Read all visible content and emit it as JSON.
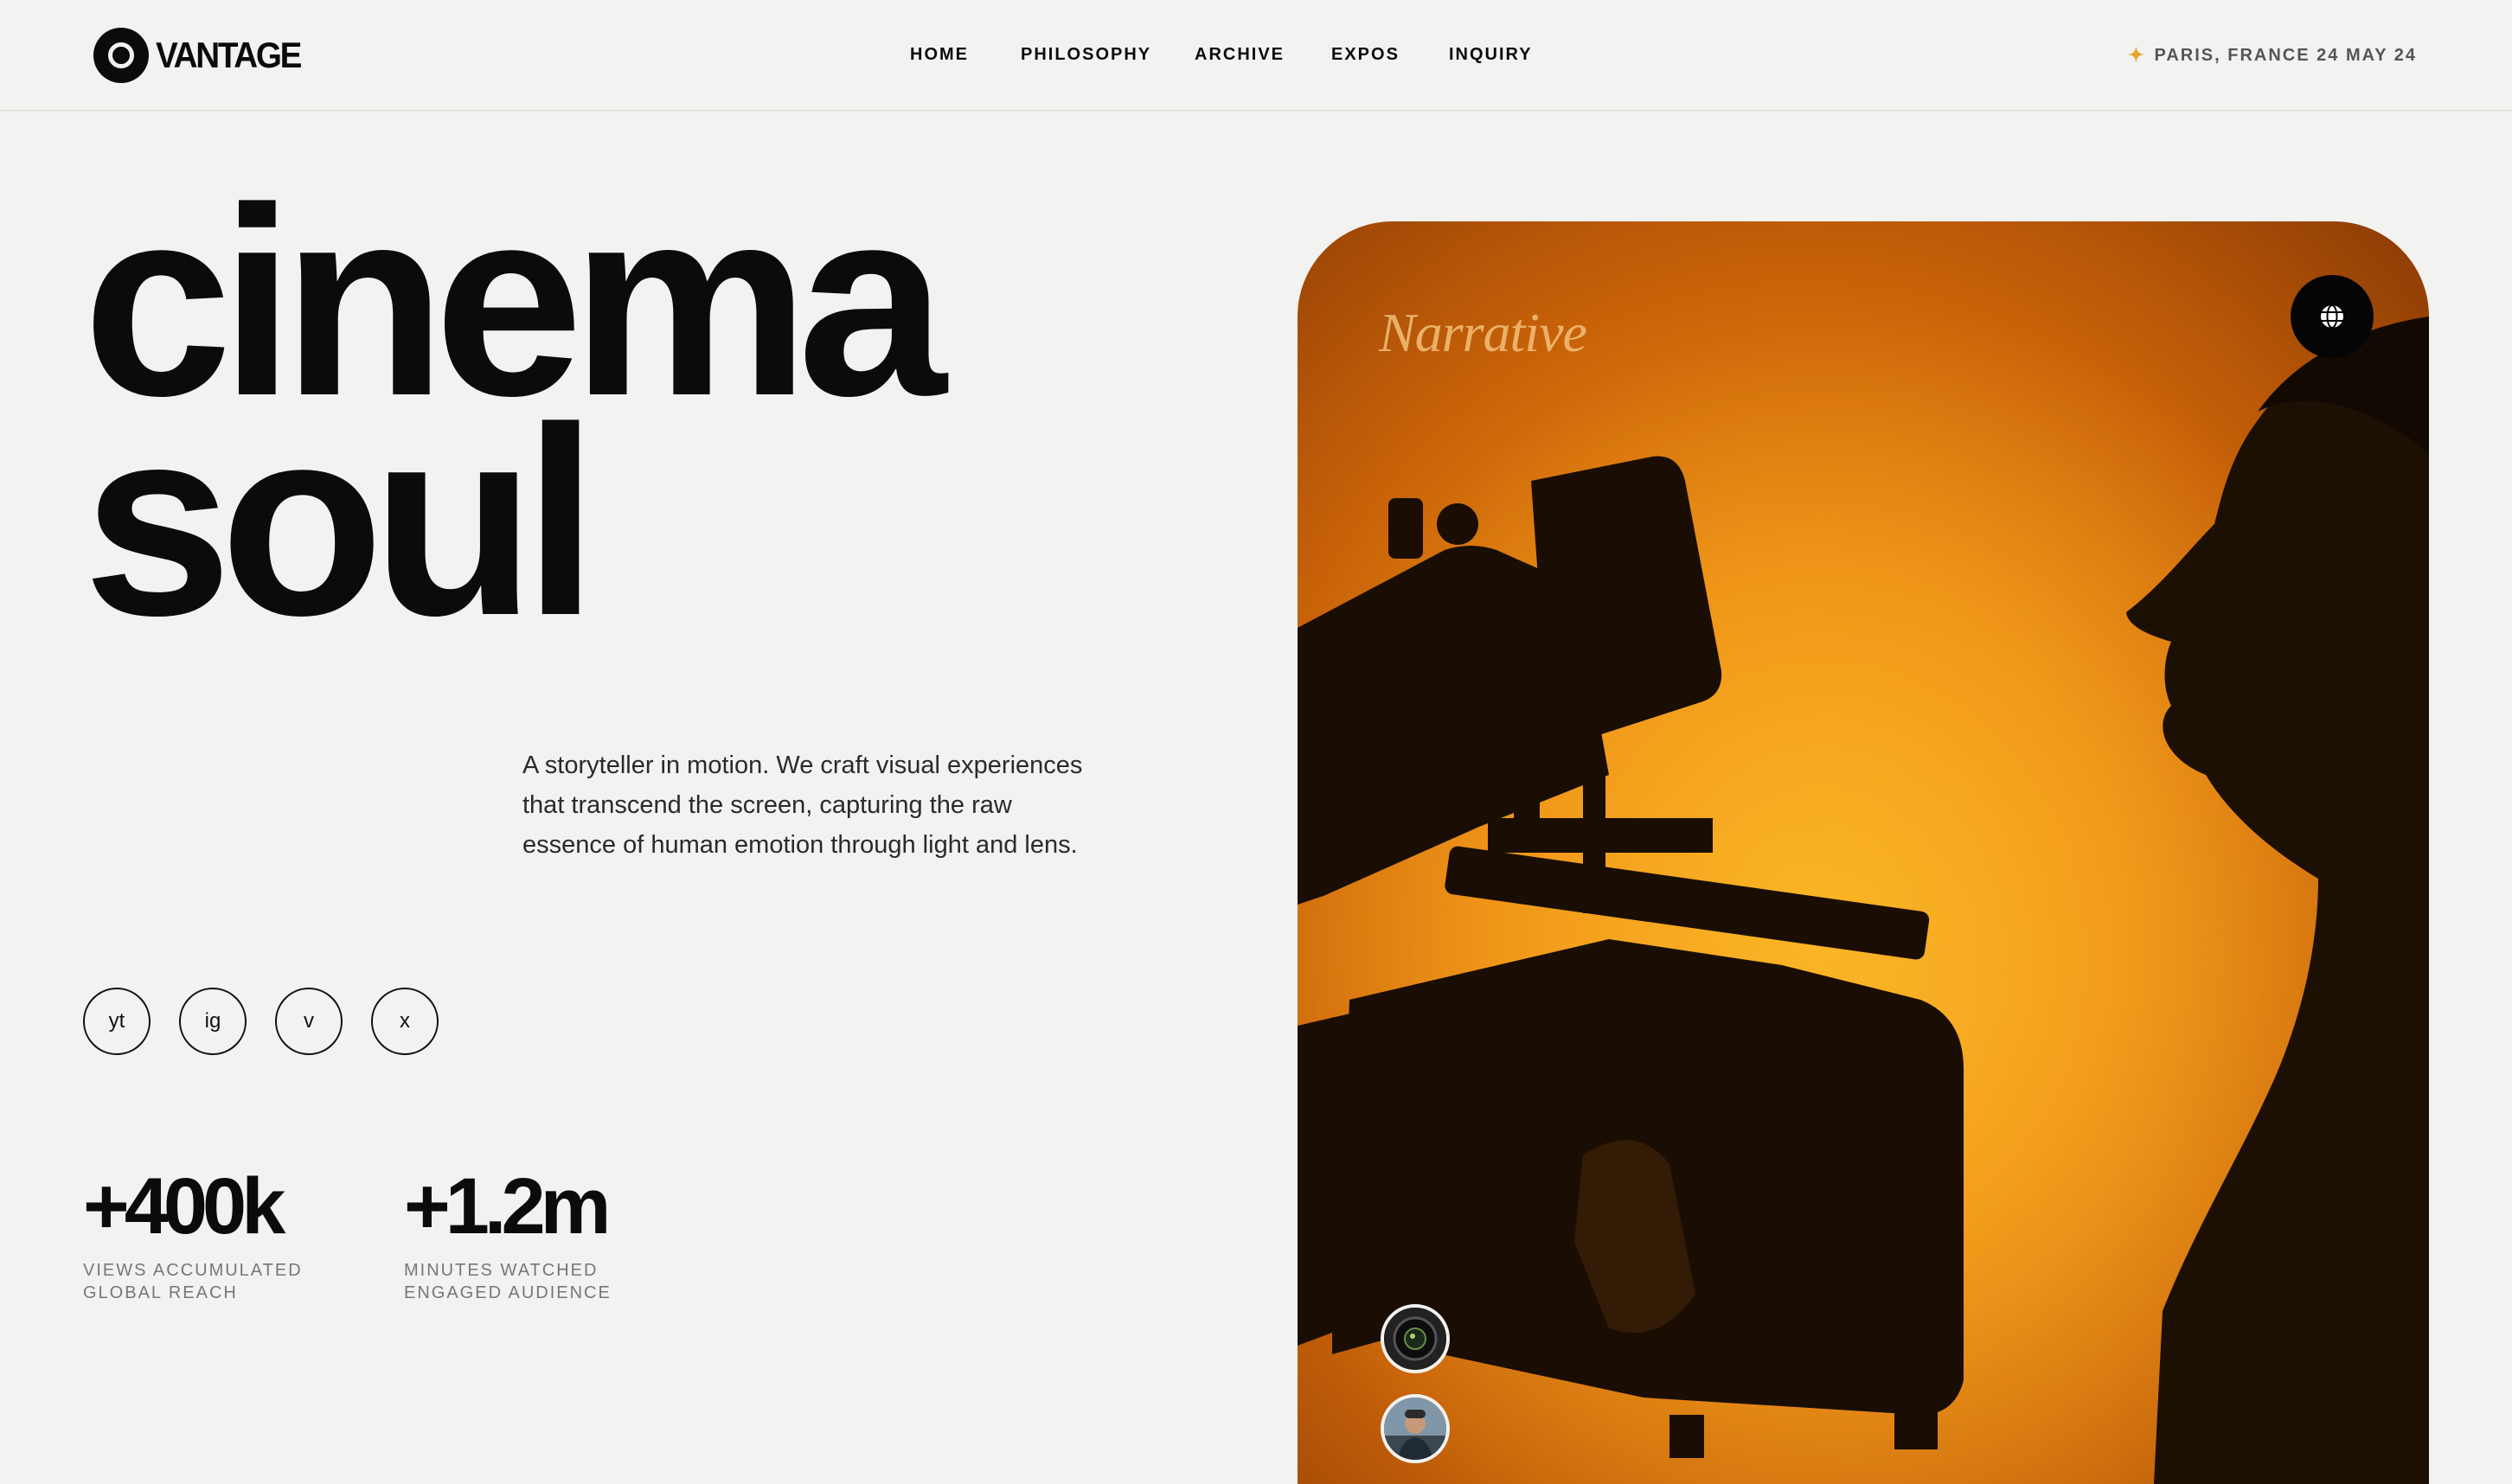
{
  "brand": {
    "name": "VANTAGE"
  },
  "nav": {
    "items": [
      {
        "label": "HOME"
      },
      {
        "label": "PHILOSOPHY"
      },
      {
        "label": "ARCHIVE"
      },
      {
        "label": "EXPOS"
      },
      {
        "label": "INQUIRY"
      }
    ]
  },
  "location": {
    "text": "PARIS, FRANCE 24 MAY 24",
    "icon": "sparkle-icon",
    "accent": "#e6a526"
  },
  "hero": {
    "line1": "cinema",
    "line2": "soul",
    "description": "A storyteller in motion. We craft visual experiences that transcend the screen, capturing the raw essence of human emotion through light and lens."
  },
  "socials": [
    {
      "label": "yt"
    },
    {
      "label": "ig"
    },
    {
      "label": "v"
    },
    {
      "label": "x"
    }
  ],
  "stats": [
    {
      "value": "+400k",
      "label_line1": "VIEWS ACCUMULATED",
      "label_line2": "GLOBAL REACH"
    },
    {
      "value": "+1.2m",
      "label_line1": "MINUTES WATCHED",
      "label_line2": "ENGAGED AUDIENCE"
    }
  ],
  "photo": {
    "caption": "Narrative",
    "button_icon": "globe-icon",
    "thumbnails": [
      {
        "icon": "camera-lens-thumbnail"
      },
      {
        "icon": "person-thumbnail"
      }
    ],
    "colors": {
      "warm": "#f7a91c",
      "deep": "#8a3a05",
      "silhouette": "#1c0f04"
    }
  }
}
